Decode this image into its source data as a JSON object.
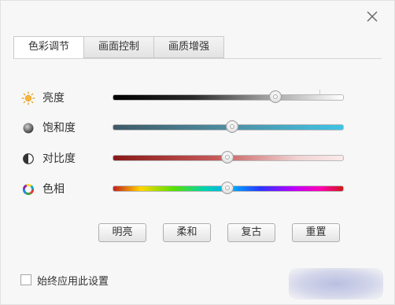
{
  "tabs": [
    {
      "label": "色彩调节",
      "active": true
    },
    {
      "label": "画面控制",
      "active": false
    },
    {
      "label": "画质增强",
      "active": false
    }
  ],
  "sliders": [
    {
      "label": "亮度",
      "icon": "sun-icon",
      "value": 0.72
    },
    {
      "label": "饱和度",
      "icon": "saturation-icon",
      "value": 0.52
    },
    {
      "label": "对比度",
      "icon": "contrast-icon",
      "value": 0.5
    },
    {
      "label": "色相",
      "icon": "hue-icon",
      "value": 0.5
    }
  ],
  "presets": {
    "bright": "明亮",
    "soft": "柔和",
    "retro": "复古",
    "reset": "重置"
  },
  "always_apply": {
    "label": "始终应用此设置",
    "checked": false
  },
  "colors": {
    "dialog_bg": "#f7f7f7",
    "sun": "#f0a020"
  }
}
